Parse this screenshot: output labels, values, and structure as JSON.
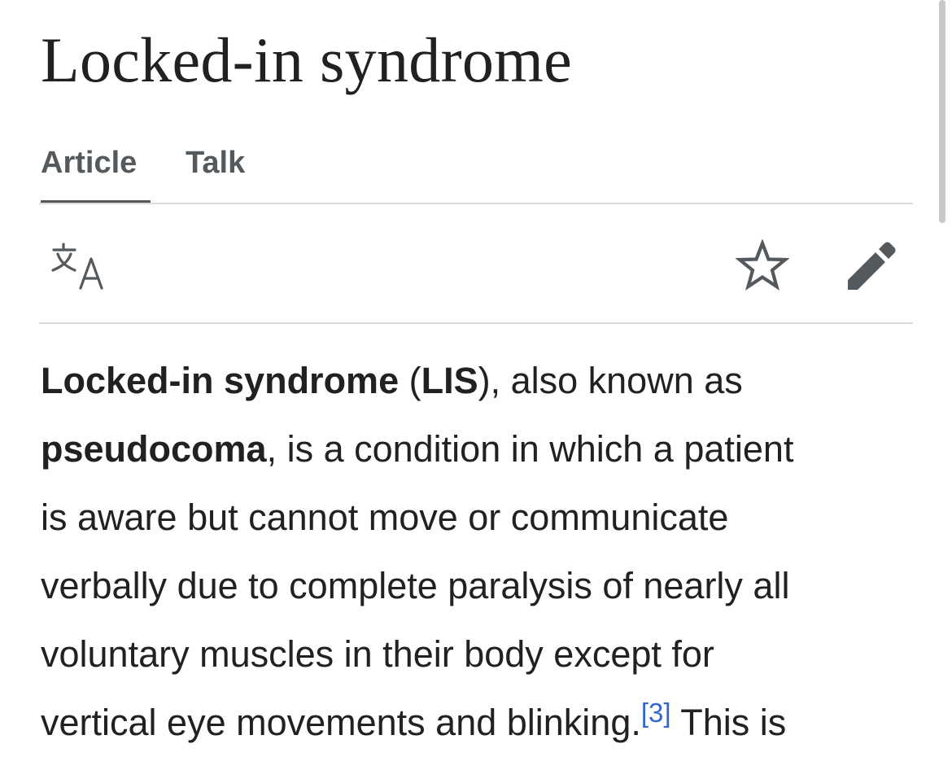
{
  "page": {
    "title": "Locked-in syndrome"
  },
  "tabs": [
    {
      "label": "Article",
      "selected": true
    },
    {
      "label": "Talk",
      "selected": false
    }
  ],
  "toolbar": {
    "language_icon": "translate-icon",
    "watch_icon": "star-icon",
    "edit_icon": "pencil-icon"
  },
  "article": {
    "lead": {
      "bold1": "Locked-in syndrome",
      "t1": " (",
      "bold2": "LIS",
      "t2": "), also known as",
      "bold3": "pseudocoma",
      "t3": ", is a condition in which a patient",
      "line3": "is aware but cannot move or communicate",
      "line4": "verbally due to complete paralysis of nearly all",
      "line5": "voluntary muscles in their body except for",
      "line6a": "vertical eye movements and blinking.",
      "ref": "[3]",
      "line6b": " This is"
    }
  },
  "colors": {
    "text": "#202122",
    "tab_text": "#54595d",
    "rule": "#d9dbdf",
    "link": "#3366cc"
  }
}
